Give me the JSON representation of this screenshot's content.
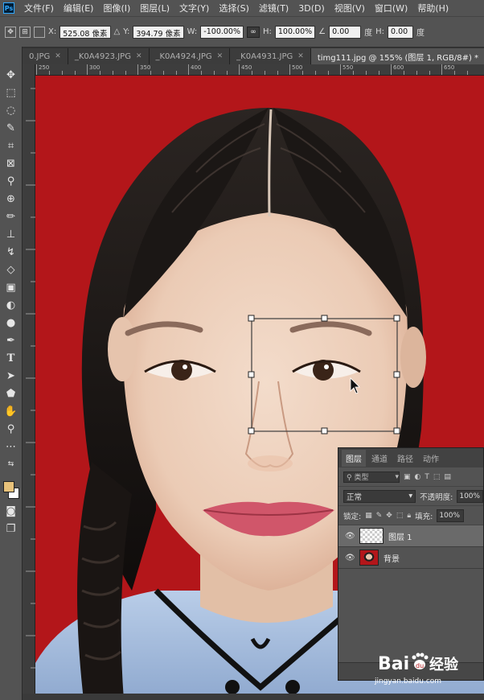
{
  "menu": {
    "app_icon": "Ps",
    "items": [
      "文件(F)",
      "编辑(E)",
      "图像(I)",
      "图层(L)",
      "文字(Y)",
      "选择(S)",
      "滤镜(T)",
      "3D(D)",
      "视图(V)",
      "窗口(W)",
      "帮助(H)"
    ]
  },
  "options": {
    "x_label": "X:",
    "x_value": "525.08 像素",
    "y_label": "Y:",
    "y_value": "394.79 像素",
    "w_label": "W:",
    "w_value": "-100.00%",
    "h_label": "H:",
    "h_value": "100.00%",
    "angle_value": "0.00",
    "angle_unit": "度",
    "h2_label": "H:",
    "h2_value": "0.00",
    "h2_unit": "度"
  },
  "tabs": [
    {
      "label": "0.JPG"
    },
    {
      "label": "_K0A4923.JPG"
    },
    {
      "label": "_K0A4924.JPG"
    },
    {
      "label": "_K0A4931.JPG"
    },
    {
      "label": "timg111.jpg @ 155% (图层 1, RGB/8#) *"
    }
  ],
  "ruler": {
    "labels": [
      "250",
      "300",
      "350",
      "400",
      "450",
      "500",
      "550",
      "600",
      "650"
    ]
  },
  "layers_panel": {
    "tabs": [
      "图层",
      "通道",
      "路径",
      "动作"
    ],
    "kind_placeholder": "类型",
    "blend_mode": "正常",
    "opacity_label": "不透明度:",
    "opacity_value": "100%",
    "lock_label": "锁定:",
    "fill_label": "填充:",
    "fill_value": "100%",
    "layers": [
      {
        "name": "图层 1",
        "selected": true
      },
      {
        "name": "背景",
        "selected": false
      }
    ]
  },
  "watermark": {
    "brand_left": "Bai",
    "brand_right": "经验",
    "url": "jingyan.baidu.com"
  },
  "colors": {
    "background_red": "#b3161a",
    "foreground_swatch": "#e8c27a",
    "background_swatch": "#ffffff"
  }
}
